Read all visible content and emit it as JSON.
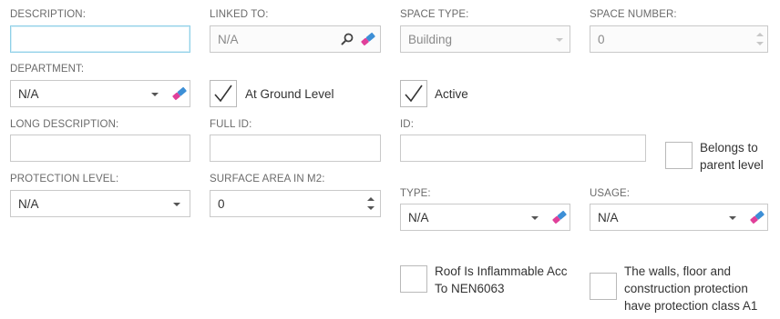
{
  "description": {
    "label": "DESCRIPTION:",
    "value": ""
  },
  "linked_to": {
    "label": "LINKED TO:",
    "value": "N/A"
  },
  "space_type": {
    "label": "SPACE TYPE:",
    "value": "Building"
  },
  "space_number": {
    "label": "SPACE NUMBER:",
    "value": "0"
  },
  "department": {
    "label": "DEPARTMENT:",
    "value": "N/A"
  },
  "at_ground_level": {
    "label": "At Ground Level",
    "checked": true
  },
  "active": {
    "label": "Active",
    "checked": true
  },
  "long_description": {
    "label": "LONG DESCRIPTION:",
    "value": ""
  },
  "full_id": {
    "label": "FULL ID:",
    "value": ""
  },
  "id": {
    "label": "ID:",
    "value": ""
  },
  "belongs_to_parent": {
    "line1": "Belongs to",
    "line2": "parent level",
    "checked": false
  },
  "protection_level": {
    "label": "PROTECTION LEVEL:",
    "value": "N/A"
  },
  "surface_area": {
    "label": "SURFACE AREA IN M2:",
    "value": "0"
  },
  "type": {
    "label": "TYPE:",
    "value": "N/A"
  },
  "usage": {
    "label": "USAGE:",
    "value": "N/A"
  },
  "roof_inflammable": {
    "line1": "Roof Is Inflammable Acc",
    "line2": "To NEN6063",
    "checked": false
  },
  "walls_protection": {
    "line1": "The walls, floor and",
    "line2": "construction protection",
    "line3": "have protection class A1",
    "checked": false
  },
  "icons": {
    "clear": "eraser-icon",
    "lookup": "magnifier-icon",
    "dropdown": "chevron-down-icon",
    "spinner": "up-down-arrows-icon",
    "check": "checkmark-icon"
  },
  "colors": {
    "focus_border": "#8fd0e8",
    "eraser_blue": "#3d8fd6",
    "eraser_pink": "#e0409a",
    "label": "#6b6b6b"
  }
}
